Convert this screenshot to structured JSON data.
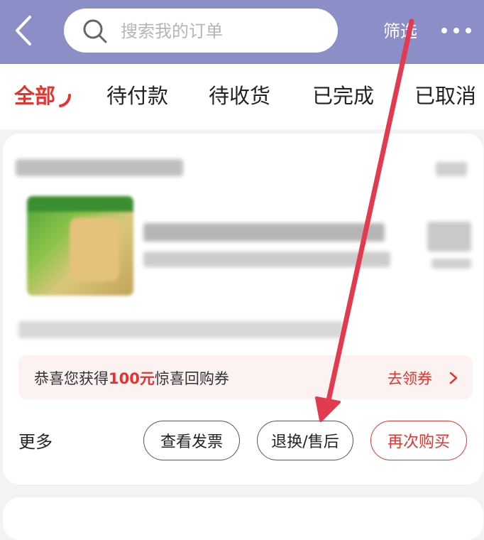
{
  "header": {
    "search_placeholder": "搜索我的订单",
    "filter_label": "筛选"
  },
  "tabs": [
    {
      "label": "全部",
      "active": true
    },
    {
      "label": "待付款",
      "active": false
    },
    {
      "label": "待收货",
      "active": false
    },
    {
      "label": "已完成",
      "active": false
    },
    {
      "label": "已取消",
      "active": false
    }
  ],
  "order": {
    "coupon": {
      "prefix": "恭喜您获得",
      "amount": "100元",
      "suffix": "惊喜回购券",
      "link_label": "去领券"
    },
    "more_label": "更多",
    "actions": {
      "invoice": "查看发票",
      "return": "退换/售后",
      "rebuy": "再次购买"
    }
  },
  "colors": {
    "header_bg": "#8c8fc7",
    "accent": "#e8322c",
    "annotation_arrow": "#e23a4f"
  }
}
